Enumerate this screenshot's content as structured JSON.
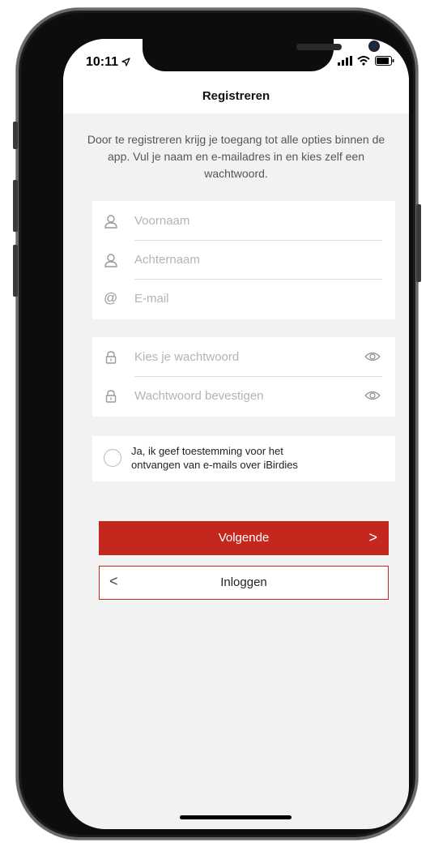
{
  "status_bar": {
    "time": "10:11"
  },
  "header": {
    "title": "Registreren"
  },
  "intro": {
    "text": "Door te registreren krijg je toegang tot alle opties binnen de app. Vul je naam en e-mailadres in en kies zelf een wachtwoord."
  },
  "form": {
    "first_name": {
      "placeholder": "Voornaam",
      "icon": "user-icon"
    },
    "last_name": {
      "placeholder": "Achternaam",
      "icon": "user-icon"
    },
    "email": {
      "placeholder": "E-mail",
      "icon": "at-icon"
    },
    "password": {
      "placeholder": "Kies je wachtwoord",
      "icon": "lock-icon",
      "toggle_icon": "eye-icon"
    },
    "password_confirm": {
      "placeholder": "Wachtwoord bevestigen",
      "icon": "lock-icon",
      "toggle_icon": "eye-icon"
    }
  },
  "consent": {
    "line1": "Ja, ik geef toestemming voor het",
    "line2": "ontvangen van e-mails over iBirdies",
    "checked": false
  },
  "buttons": {
    "next_label": "Volgende",
    "next_chevron": ">",
    "login_label": "Inloggen",
    "login_chevron": "<"
  },
  "colors": {
    "accent": "#c3271d",
    "background": "#f2f2f3",
    "card": "#ffffff",
    "placeholder": "#b4b4b4"
  }
}
